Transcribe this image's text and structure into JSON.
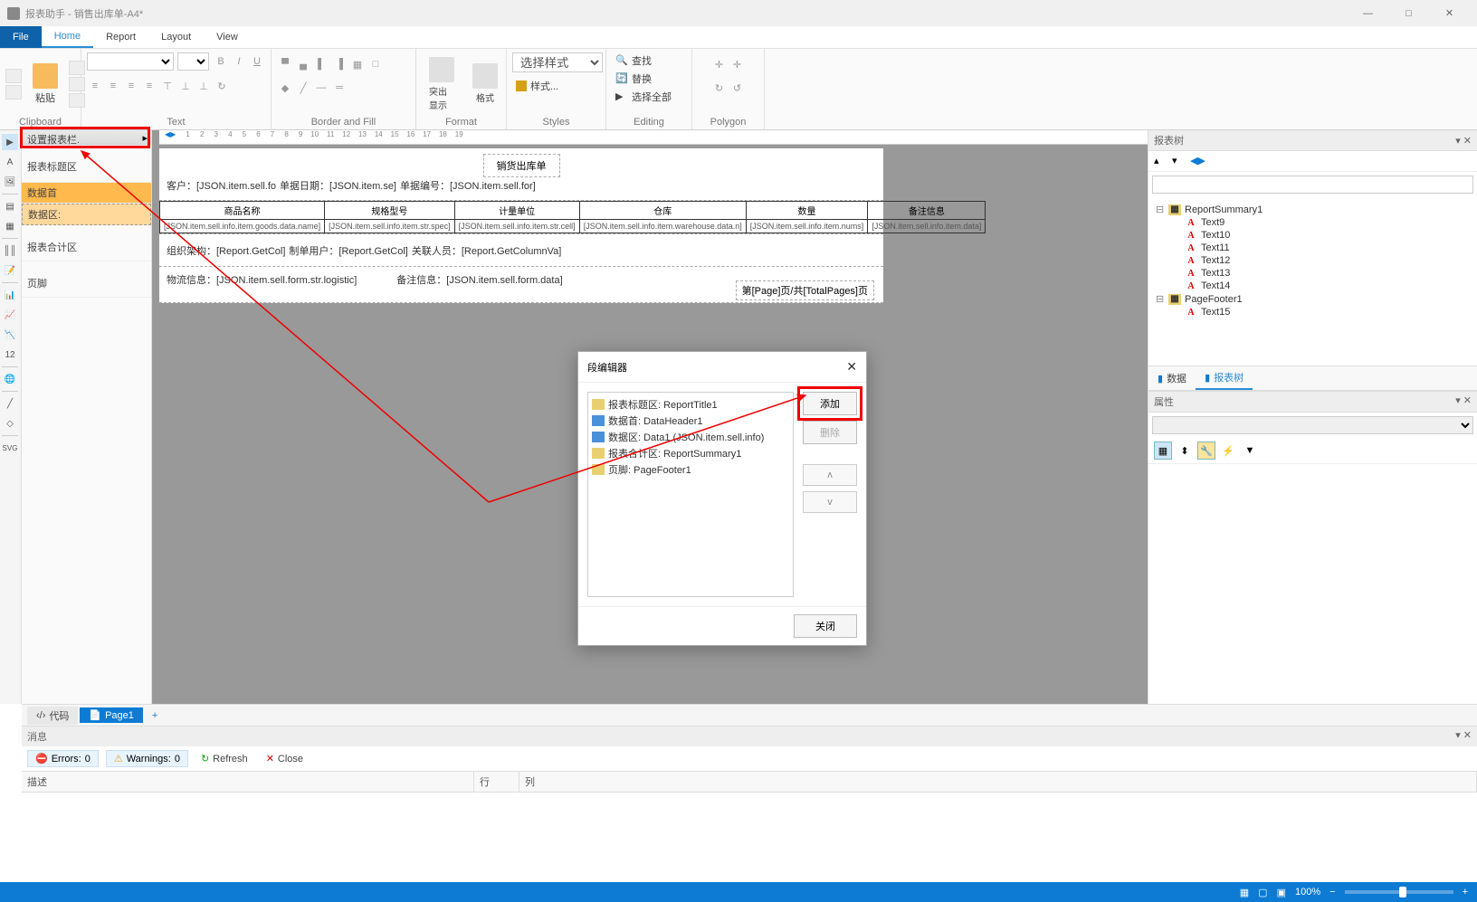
{
  "app": {
    "title": "报表助手 - 销售出库单-A4*"
  },
  "menu": {
    "file": "File",
    "home": "Home",
    "report": "Report",
    "layout": "Layout",
    "view": "View"
  },
  "ribbon": {
    "clipboard": {
      "paste": "粘贴",
      "label": "Clipboard"
    },
    "text": {
      "label": "Text"
    },
    "border": {
      "label": "Border and Fill"
    },
    "format": {
      "highlight": "突出显示",
      "style": "格式",
      "label": "Format"
    },
    "styles": {
      "select": "选择样式",
      "style_btn": "样式...",
      "label": "Styles"
    },
    "editing": {
      "find": "查找",
      "replace": "替换",
      "selectall": "选择全部",
      "label": "Editing"
    },
    "polygon": {
      "label": "Polygon"
    }
  },
  "bands_panel": {
    "setup": "设置报表栏.",
    "title_band": "报表标题区",
    "data_header": "数据首",
    "data_band": "数据区:",
    "summary": "报表合计区",
    "footer": "页脚"
  },
  "report": {
    "title": "销货出库单",
    "row1": {
      "customer": "客户：[JSON.item.sell.fo",
      "date": "单据日期：[JSON.item.se]",
      "billno": "单据编号：[JSON.item.sell.for]"
    },
    "headers": [
      "商品名称",
      "规格型号",
      "计量单位",
      "仓库",
      "数量",
      "备注信息"
    ],
    "data_cells": [
      "[JSON.item.sell.info.item.goods.data.name]",
      "[JSON.item.sell.info.item.str.spec]",
      "[JSON.item.sell.info.item.str.cell]",
      "[JSON.item.sell.info.item.warehouse.data.n]",
      "[JSON.item.sell.info.item.nums]",
      "[JSON.item.sell.info.item.data]"
    ],
    "summary_row": {
      "org": "组织架构：[Report.GetCol]",
      "user": "制单用户：[Report.GetCol]",
      "person": "关联人员：[Report.GetColumnVa]"
    },
    "footer_row": {
      "logistic": "物流信息：[JSON.item.sell.form.str.logistic]",
      "remark": "备注信息：[JSON.item.sell.form.data]"
    },
    "page_info": "第[Page]页/共[TotalPages]页"
  },
  "dialog": {
    "title": "段编辑器",
    "items": [
      "报表标题区: ReportTitle1",
      "数据首: DataHeader1",
      "数据区: Data1 (JSON.item.sell.info)",
      "报表合计区: ReportSummary1",
      "页脚: PageFooter1"
    ],
    "add": "添加",
    "delete": "删除",
    "close": "关闭"
  },
  "tree_panel": {
    "title": "报表树",
    "root": "ReportSummary1",
    "children": [
      "Text9",
      "Text10",
      "Text11",
      "Text12",
      "Text13",
      "Text14"
    ],
    "footer_node": "PageFooter1",
    "footer_children": [
      "Text15"
    ],
    "tab_data": "数据",
    "tab_tree": "报表树"
  },
  "props": {
    "title": "属性"
  },
  "page_tabs": {
    "code": "代码",
    "page1": "Page1"
  },
  "messages": {
    "title": "消息",
    "errors_label": "Errors:",
    "errors_count": "0",
    "warnings_label": "Warnings:",
    "warnings_count": "0",
    "refresh": "Refresh",
    "close": "Close",
    "col_desc": "描述",
    "col_row": "行",
    "col_col": "列"
  },
  "status": {
    "zoom": "100%"
  }
}
